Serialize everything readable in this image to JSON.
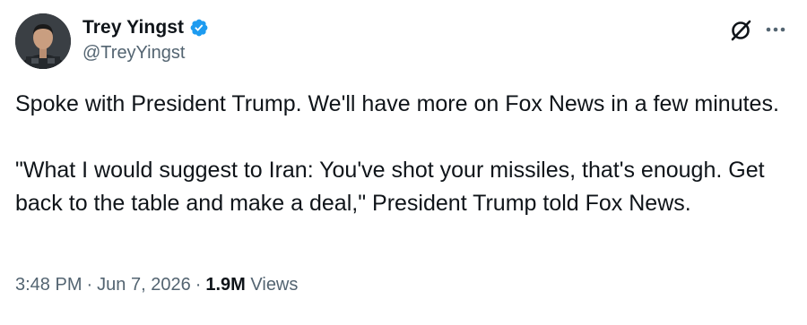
{
  "author": {
    "display_name": "Trey Yingst",
    "handle": "@TreyYingst",
    "verified": true
  },
  "tweet": {
    "paragraphs": [
      "Spoke with President Trump. We'll have more on Fox News in a few minutes.",
      "\"What I would suggest to Iran: You've shot your missiles, that's enough. Get back to the table and make a deal,\" President Trump told Fox News."
    ],
    "time": "3:48 PM",
    "date": "Jun 7, 2026",
    "separator": "·",
    "views_count": "1.9M",
    "views_label": "Views"
  },
  "icons": {
    "verified": "verified-badge-icon",
    "grok": "grok-icon",
    "more": "more-options-icon"
  },
  "colors": {
    "verified_blue": "#1d9bf0",
    "text_primary": "#0f1419",
    "text_secondary": "#536471"
  }
}
